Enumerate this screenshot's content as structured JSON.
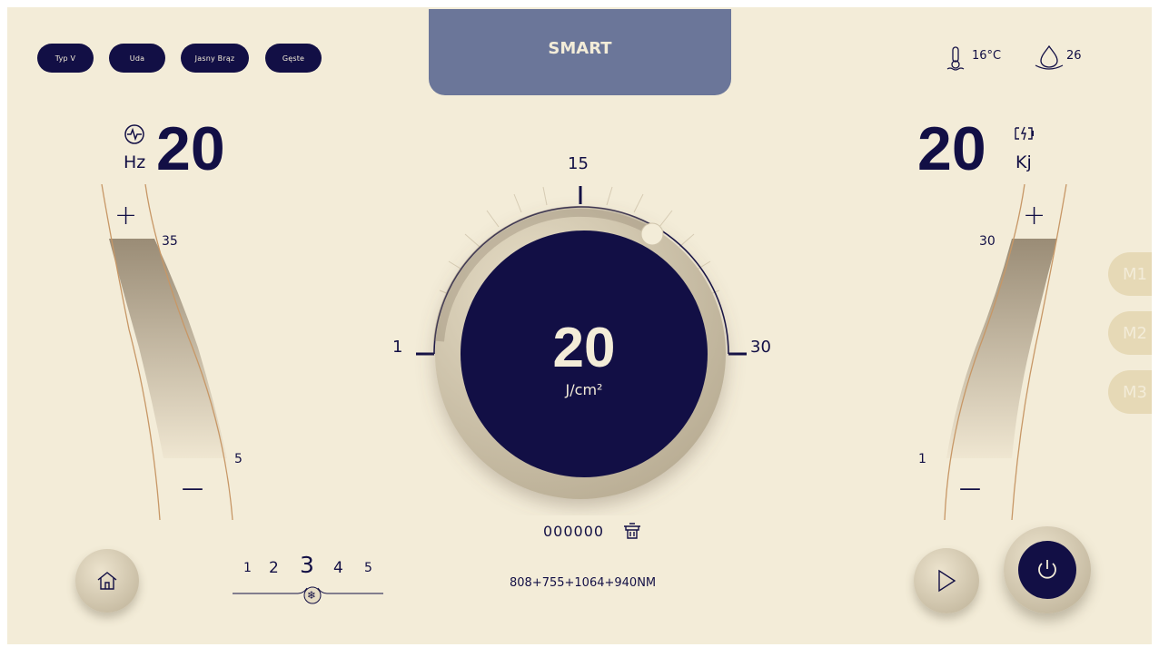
{
  "tags": [
    "Typ V",
    "Uda",
    "Jasny Brąz",
    "Gęste"
  ],
  "mode": {
    "label": "SMART"
  },
  "status": {
    "temperature": "16°C",
    "water": "26"
  },
  "left": {
    "value": "20",
    "unit": "Hz",
    "max_label": "35",
    "min_label": "5",
    "level": 0.83,
    "plus": "+",
    "minus": "—"
  },
  "right": {
    "value": "20",
    "unit": "Kj",
    "max_label": "30",
    "min_label": "1",
    "level": 0.82,
    "plus": "+",
    "minus": "—"
  },
  "dial": {
    "value": "20",
    "unit": "J/cm²",
    "min": "1",
    "mid": "15",
    "max": "30",
    "level": 0.63
  },
  "counter": "000000",
  "cooling": {
    "levels": [
      "1",
      "2",
      "3",
      "4",
      "5"
    ],
    "selected": "3"
  },
  "wavelength": "808+755+1064+940NM",
  "memory": [
    "M1",
    "M2",
    "M3"
  ],
  "colors": {
    "navy": "#120f45",
    "bg": "#f3ecd8",
    "panel": "#6b7699",
    "gauge": "#a39680",
    "tab": "#e6d9b6"
  }
}
